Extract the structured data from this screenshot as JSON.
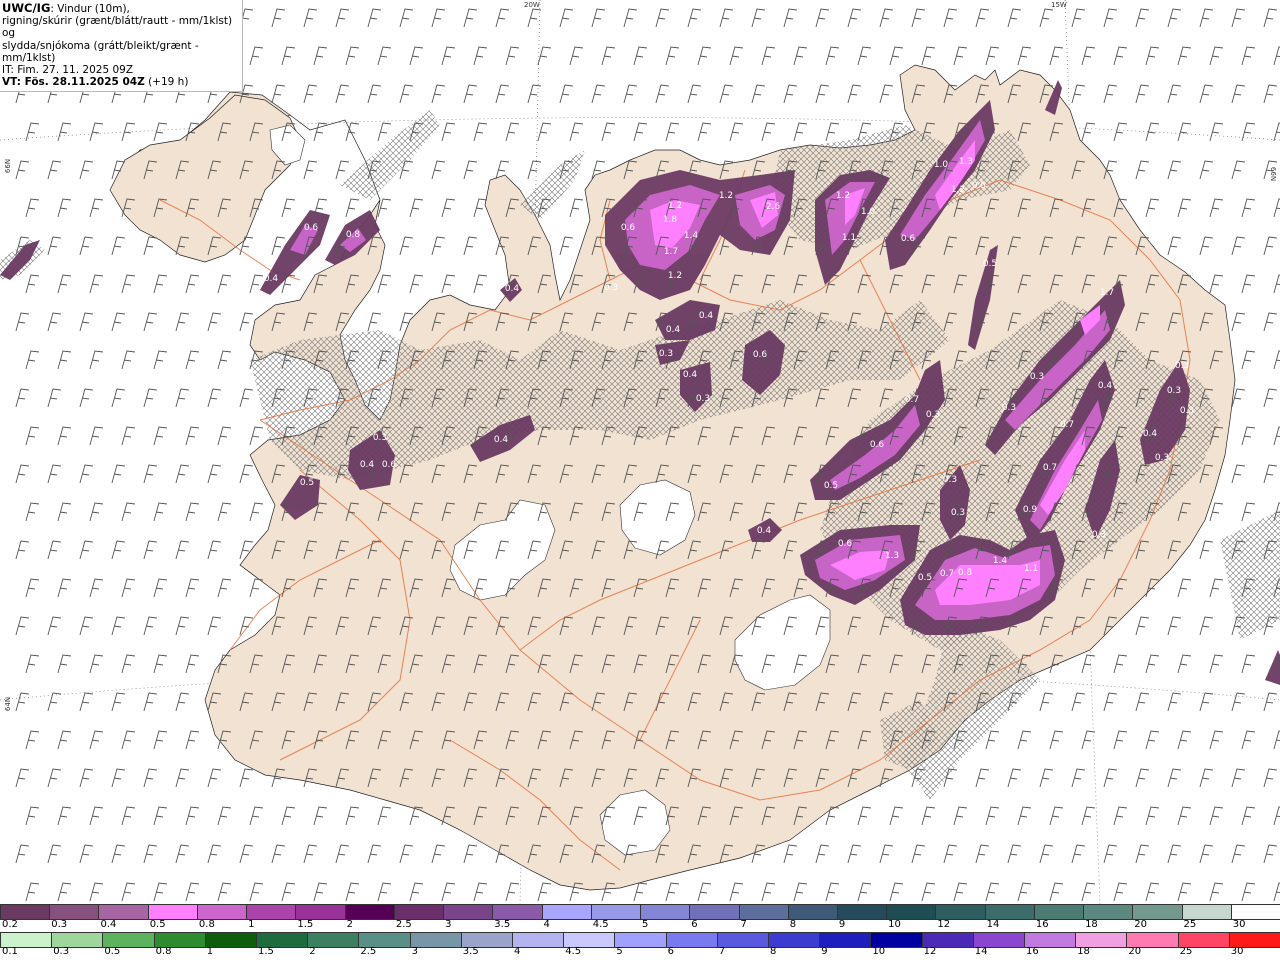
{
  "header": {
    "title_bold": "UWC/IG",
    "title_rest": ": Vindur (10m),",
    "line2": "rigning/skúrir (grænt/blátt/rautt - mm/1klst) og",
    "line3": "slydda/snjókoma (grátt/bleikt/grænt - mm/1klst)",
    "line4": "IT: Fim. 27. 11. 2025 09Z",
    "line5_bold": "VT: Fös. 28.11.2025 04Z",
    "line5_rest": " (+19 h)"
  },
  "coords": {
    "top_20w": "20W",
    "top_15w": "15W",
    "left_66n": "66N",
    "left_64n": "64N",
    "right_66n": "66N"
  },
  "legend_top": {
    "labels": [
      "0.2",
      "0.3",
      "0.4",
      "0.5",
      "0.8",
      "1",
      "1.5",
      "2",
      "2.5",
      "3",
      "3.5",
      "4",
      "4.5",
      "5",
      "6",
      "7",
      "8",
      "9",
      "10",
      "12",
      "14",
      "16",
      "18",
      "20",
      "25",
      "30"
    ],
    "colors": [
      "#6b3a63",
      "#87507f",
      "#a765a3",
      "#ff80ff",
      "#cc66cc",
      "#aa44aa",
      "#993399",
      "#550055",
      "#6a2e6a",
      "#7a448a",
      "#8a5aa8",
      "#a9a6ff",
      "#9898e8",
      "#8585d6",
      "#6f70b8",
      "#5e6e9c",
      "#3e5a78",
      "#244a5c",
      "#1e4d54",
      "#2e5e60",
      "#3c6d6a",
      "#4c7b74",
      "#5d8880",
      "#73988e",
      "#c8d6d0",
      "#ffffff"
    ]
  },
  "legend_bottom": {
    "labels": [
      "0.1",
      "0.3",
      "0.5",
      "0.8",
      "1",
      "1.5",
      "2",
      "2.5",
      "3",
      "3.5",
      "4",
      "4.5",
      "5",
      "6",
      "7",
      "8",
      "9",
      "10",
      "12",
      "14",
      "16",
      "18",
      "20",
      "25",
      "30"
    ],
    "colors": [
      "#ccf2cc",
      "#9ed69e",
      "#5db35d",
      "#2e8b2e",
      "#0d5d0d",
      "#1e6b3e",
      "#3d8060",
      "#5a8f88",
      "#7797a6",
      "#9aa4c8",
      "#b4b4f0",
      "#c9c9ff",
      "#a0a0ff",
      "#7a7af0",
      "#5a5ae0",
      "#3c3cd0",
      "#1e1ebe",
      "#0000a0",
      "#4b2ab8",
      "#8a46d0",
      "#c07ae0",
      "#f0a0e0",
      "#ff7ab0",
      "#ff4466",
      "#ff1a1a"
    ]
  },
  "precip_values": [
    {
      "label": "0.6"
    },
    {
      "label": "0.8"
    },
    {
      "label": "0.4"
    },
    {
      "label": "0.4"
    },
    {
      "label": "0.6"
    },
    {
      "label": "1.2"
    },
    {
      "label": "1.8"
    },
    {
      "label": "1.4"
    },
    {
      "label": "1.7"
    },
    {
      "label": "1.2"
    },
    {
      "label": "0.3"
    },
    {
      "label": "1.2"
    },
    {
      "label": "2.6"
    },
    {
      "label": "1.2"
    },
    {
      "label": "1.0"
    },
    {
      "label": "1.1"
    },
    {
      "label": "1.0"
    },
    {
      "label": "1.3"
    },
    {
      "label": "1.2"
    },
    {
      "label": "0.5"
    },
    {
      "label": "0.6"
    },
    {
      "label": "0.5"
    },
    {
      "label": "0.4"
    },
    {
      "label": "0.4"
    },
    {
      "label": "0.3"
    },
    {
      "label": "0.4"
    },
    {
      "label": "0.3"
    },
    {
      "label": "0.6"
    },
    {
      "label": "1.7"
    },
    {
      "label": "0.3"
    },
    {
      "label": "0.3"
    },
    {
      "label": "0.4"
    },
    {
      "label": "0.3"
    },
    {
      "label": "0.3"
    },
    {
      "label": "0.3"
    },
    {
      "label": "0.7"
    },
    {
      "label": "0.3"
    },
    {
      "label": "0.4"
    },
    {
      "label": "0.3"
    },
    {
      "label": "0.4"
    },
    {
      "label": "0.3"
    },
    {
      "label": "0.5"
    },
    {
      "label": "0.4"
    },
    {
      "label": "0.6"
    },
    {
      "label": "0.6"
    },
    {
      "label": "0.7"
    },
    {
      "label": "0.5"
    },
    {
      "label": "0.3"
    },
    {
      "label": "0.3"
    },
    {
      "label": "0.7"
    },
    {
      "label": "0.9"
    },
    {
      "label": "0.3"
    },
    {
      "label": "0.6"
    },
    {
      "label": "1.3"
    },
    {
      "label": "0.5"
    },
    {
      "label": "0.7"
    },
    {
      "label": "0.8"
    },
    {
      "label": "1.4"
    },
    {
      "label": "1.1"
    },
    {
      "label": "0.4"
    }
  ]
}
